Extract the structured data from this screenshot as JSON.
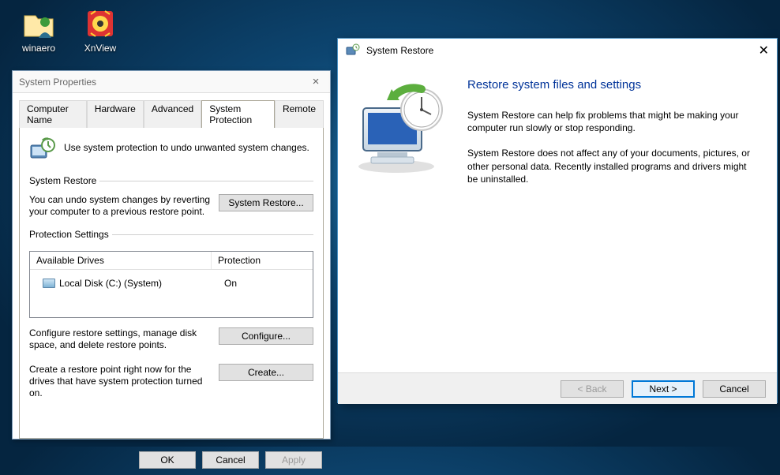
{
  "desktop": {
    "icons": [
      {
        "label": "winaero"
      },
      {
        "label": "XnView"
      }
    ]
  },
  "sysprop": {
    "title": "System Properties",
    "tabs": [
      "Computer Name",
      "Hardware",
      "Advanced",
      "System Protection",
      "Remote"
    ],
    "active_tab": 3,
    "intro_text": "Use system protection to undo unwanted system changes.",
    "system_restore_section": {
      "legend": "System Restore",
      "text": "You can undo system changes by reverting your computer to a previous restore point.",
      "button": "System Restore..."
    },
    "protection_section": {
      "legend": "Protection Settings",
      "col_drive": "Available Drives",
      "col_protection": "Protection",
      "rows": [
        {
          "drive": "Local Disk (C:) (System)",
          "protection": "On"
        }
      ],
      "configure_text": "Configure restore settings, manage disk space, and delete restore points.",
      "configure_button": "Configure...",
      "create_text": "Create a restore point right now for the drives that have system protection turned on.",
      "create_button": "Create..."
    },
    "footer": {
      "ok": "OK",
      "cancel": "Cancel",
      "apply": "Apply"
    }
  },
  "restore": {
    "title": "System Restore",
    "heading": "Restore system files and settings",
    "p1": "System Restore can help fix problems that might be making your computer run slowly or stop responding.",
    "p2": "System Restore does not affect any of your documents, pictures, or other personal data. Recently installed programs and drivers might be uninstalled.",
    "footer": {
      "back": "< Back",
      "next": "Next >",
      "cancel": "Cancel"
    }
  }
}
